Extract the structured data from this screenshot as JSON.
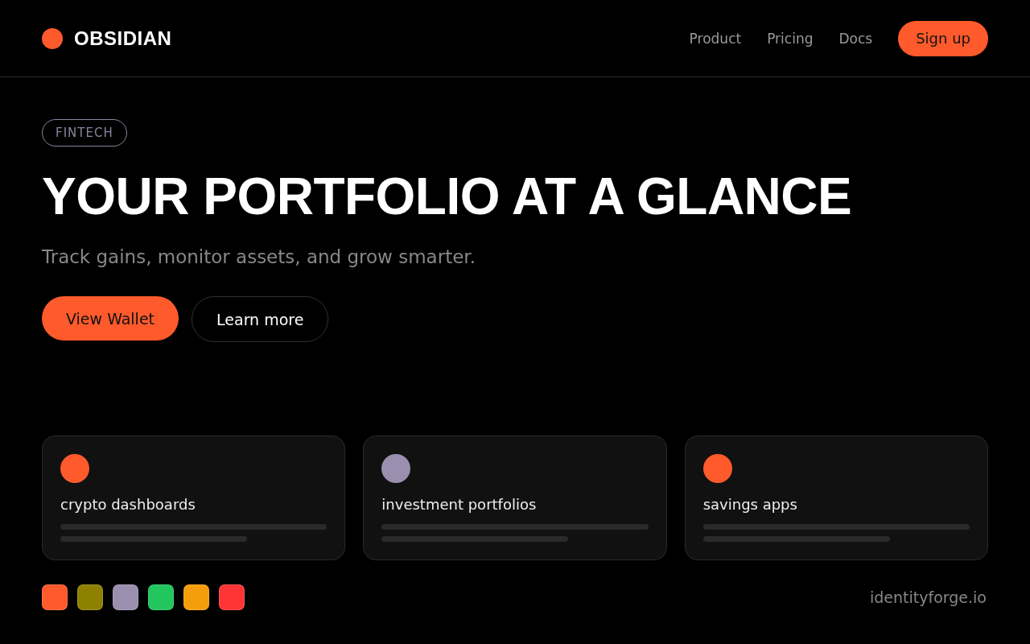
{
  "brand": {
    "name": "OBSIDIAN"
  },
  "nav": [
    {
      "label": "Product"
    },
    {
      "label": "Pricing"
    },
    {
      "label": "Docs"
    }
  ],
  "signup": "Sign up",
  "hero": {
    "tag": "FINTECH",
    "title": "YOUR PORTFOLIO AT A GLANCE",
    "subtitle": "Track gains, monitor assets, and grow smarter.",
    "primary": "View Wallet",
    "secondary": "Learn more"
  },
  "cards": [
    {
      "label": "crypto dashboards",
      "color": "#ff5a2b"
    },
    {
      "label": "investment portfolios",
      "color": "#9b8fb0"
    },
    {
      "label": "savings apps",
      "color": "#ff5a2b"
    }
  ],
  "swatches": [
    {
      "color": "#ff5a2b"
    },
    {
      "color": "#8e8000"
    },
    {
      "color": "#9b8fb0"
    },
    {
      "color": "#22c55e"
    },
    {
      "color": "#f59e0b"
    },
    {
      "color": "#ff3535"
    }
  ],
  "footer": "identityforge.io"
}
